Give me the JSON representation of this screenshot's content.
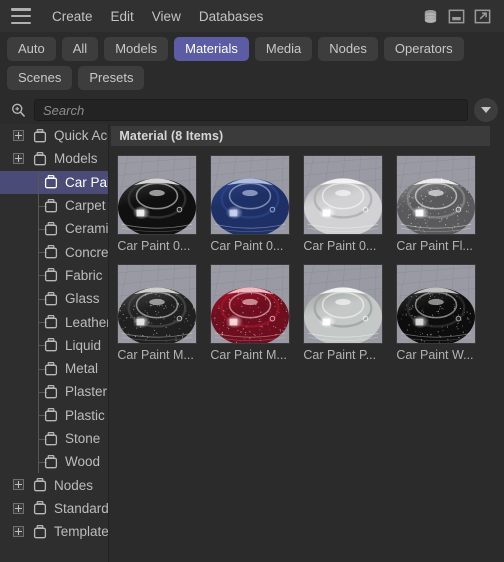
{
  "window": {
    "menu_icon": "hamburger-icon",
    "menus": [
      "Create",
      "Edit",
      "View",
      "Databases"
    ],
    "header_icons": [
      {
        "name": "database-icon",
        "title": "Databases"
      },
      {
        "name": "minimize-panel-icon",
        "title": "Minimize"
      },
      {
        "name": "popout-window-icon",
        "title": "Open in new window"
      }
    ]
  },
  "filter_tabs": {
    "row1": [
      {
        "label": "Auto",
        "active": false
      },
      {
        "label": "All",
        "active": false
      },
      {
        "label": "Models",
        "active": false
      },
      {
        "label": "Materials",
        "active": true
      },
      {
        "label": "Media",
        "active": false
      },
      {
        "label": "Nodes",
        "active": false
      },
      {
        "label": "Operators",
        "active": false
      }
    ],
    "row2": [
      {
        "label": "Scenes",
        "active": false
      },
      {
        "label": "Presets",
        "active": false
      }
    ],
    "active_color": "#5c5ca4",
    "inactive_color": "#3d3d3d"
  },
  "search": {
    "icon": "search-zoom-icon",
    "value": "",
    "placeholder": "Search",
    "filter_icon": "chevron-down-icon"
  },
  "tree": {
    "selected_color": "#4b4b78",
    "items": [
      {
        "label": "Quick Access",
        "depth": 0,
        "expandable": true,
        "selected": false
      },
      {
        "label": "Models",
        "depth": 0,
        "expandable": true,
        "selected": false
      },
      {
        "label": "Car Paint",
        "depth": 1,
        "expandable": false,
        "selected": true
      },
      {
        "label": "Carpet",
        "depth": 1,
        "expandable": false,
        "selected": false
      },
      {
        "label": "Ceramic",
        "depth": 1,
        "expandable": false,
        "selected": false
      },
      {
        "label": "Concrete",
        "depth": 1,
        "expandable": false,
        "selected": false
      },
      {
        "label": "Fabric",
        "depth": 1,
        "expandable": false,
        "selected": false
      },
      {
        "label": "Glass",
        "depth": 1,
        "expandable": false,
        "selected": false
      },
      {
        "label": "Leather",
        "depth": 1,
        "expandable": false,
        "selected": false
      },
      {
        "label": "Liquid",
        "depth": 1,
        "expandable": false,
        "selected": false
      },
      {
        "label": "Metal",
        "depth": 1,
        "expandable": false,
        "selected": false
      },
      {
        "label": "Plaster",
        "depth": 1,
        "expandable": false,
        "selected": false
      },
      {
        "label": "Plastic",
        "depth": 1,
        "expandable": false,
        "selected": false
      },
      {
        "label": "Stone",
        "depth": 1,
        "expandable": false,
        "selected": false
      },
      {
        "label": "Wood",
        "depth": 1,
        "expandable": false,
        "selected": false
      },
      {
        "label": "Nodes",
        "depth": 0,
        "expandable": true,
        "selected": false
      },
      {
        "label": "Standard & Physical",
        "depth": 0,
        "expandable": true,
        "selected": false
      },
      {
        "label": "Templates & Presets",
        "depth": 0,
        "expandable": true,
        "selected": false
      }
    ]
  },
  "content": {
    "group_header": "Material (8 Items)",
    "items": [
      {
        "label": "Car Paint 0...",
        "base": "#101010",
        "hi": "#f2f2f2",
        "mid": "#3a3a3a",
        "flake": false
      },
      {
        "label": "Car Paint 0...",
        "base": "#1e3066",
        "hi": "#c9d4ee",
        "mid": "#2c4488",
        "flake": false
      },
      {
        "label": "Car Paint 0...",
        "base": "#d2d2d4",
        "hi": "#ffffff",
        "mid": "#a9a9ad",
        "flake": false
      },
      {
        "label": "Car Paint Fl...",
        "base": "#5a5a5c",
        "hi": "#ffffff",
        "mid": "#8a8a8c",
        "flake": true
      },
      {
        "label": "Car Paint M...",
        "base": "#202020",
        "hi": "#e8e8e8",
        "mid": "#4a4a4a",
        "flake": true
      },
      {
        "label": "Car Paint M...",
        "base": "#6e0e1e",
        "hi": "#ffd9de",
        "mid": "#a3152b",
        "flake": true
      },
      {
        "label": "Car Paint P...",
        "base": "#c4c8c6",
        "hi": "#ffffff",
        "mid": "#9aa09d",
        "flake": false
      },
      {
        "label": "Car Paint W...",
        "base": "#0d0d0d",
        "hi": "#dcdcdc",
        "mid": "#303030",
        "flake": true
      }
    ]
  }
}
